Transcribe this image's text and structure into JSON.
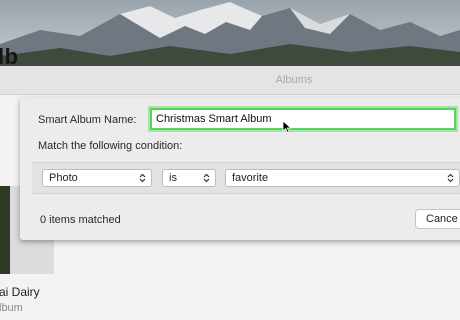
{
  "window": {
    "title": "Albums"
  },
  "background": {
    "heading": "lb",
    "album_name": "ai Dairy",
    "album_sub": "lbum"
  },
  "dialog": {
    "name_label": "Smart Album Name:",
    "name_value": "Christmas Smart Album",
    "condition_label": "Match the following condition:",
    "condition": {
      "field": "Photo",
      "operator": "is",
      "value": "favorite"
    },
    "matched_text": "0 items matched",
    "cancel_label": "Cance"
  },
  "colors": {
    "focus_ring": "#55d55a"
  },
  "icons": [
    "chevron-updown-icon",
    "cursor-icon"
  ]
}
